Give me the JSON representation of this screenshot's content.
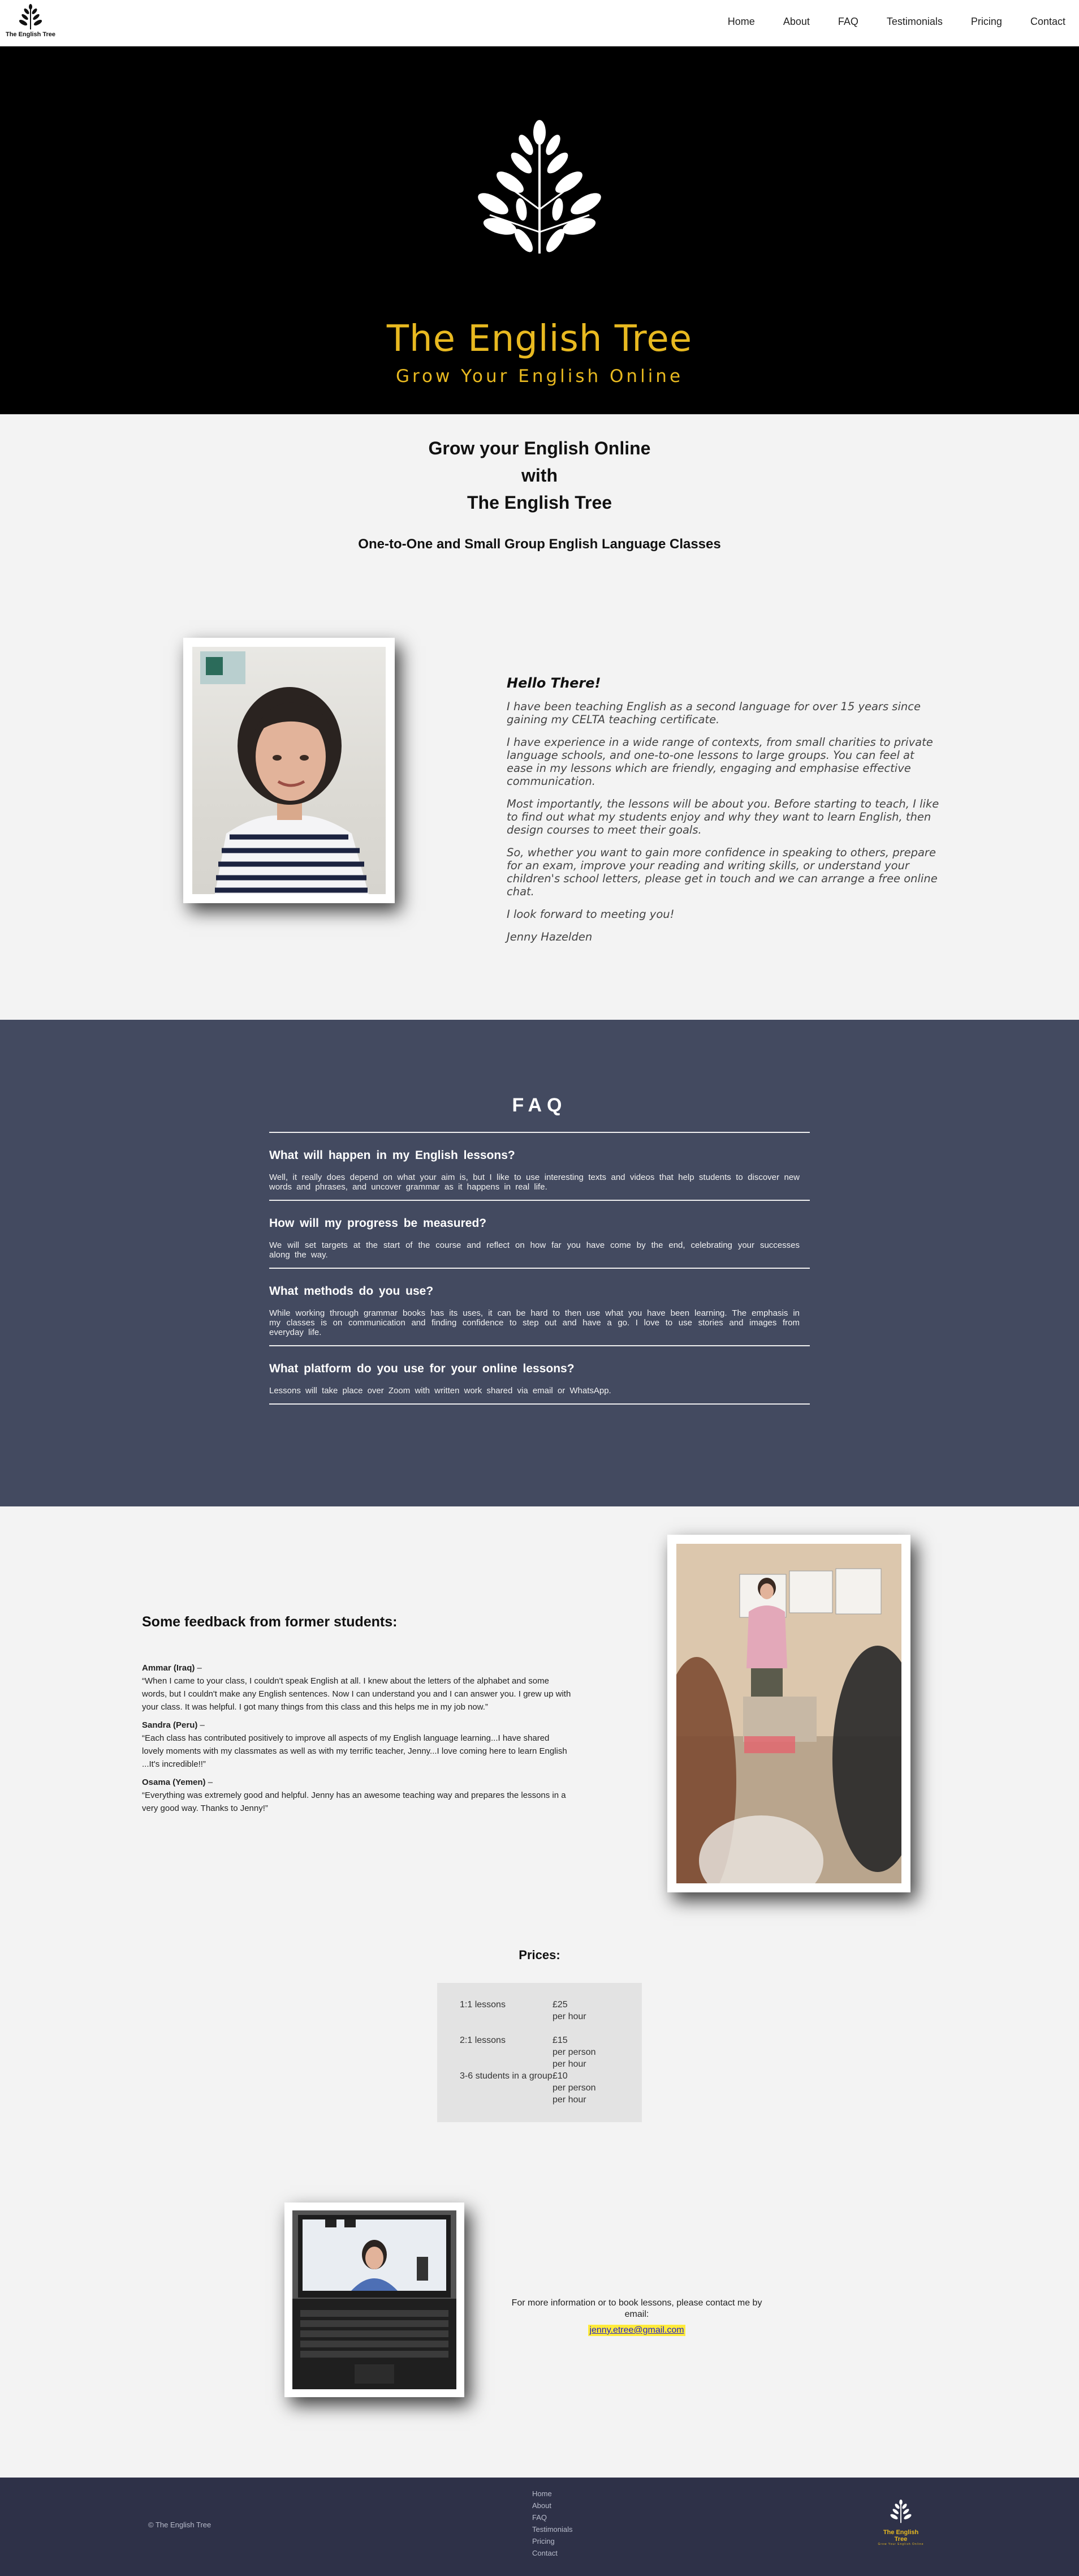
{
  "nav": {
    "logo_text": "The English Tree",
    "links": [
      "Home",
      "About",
      "FAQ",
      "Testimonials",
      "Pricing",
      "Contact"
    ]
  },
  "hero": {
    "title": "The English Tree",
    "subtitle": "Grow Your English Online"
  },
  "intro": {
    "heading_lines": [
      "Grow your English Online",
      "with",
      "The English Tree"
    ],
    "subheading": "One-to-One and Small Group English Language Classes"
  },
  "about": {
    "greeting": "Hello There!",
    "paragraphs": [
      "I have been teaching English as a second language for over 15 years since gaining my CELTA teaching certificate.",
      "I have experience in a wide range of contexts, from small charities to private language schools, and one-to-one lessons to large groups. You can feel at ease in my lessons which are friendly, engaging and emphasise effective communication.",
      "Most importantly, the lessons will be about you. Before starting to teach, I like to find out what my students enjoy and why they want to learn English, then design courses to meet their goals.",
      "So, whether you want to gain more confidence in speaking to others, prepare for an exam, improve your reading and writing skills, or understand your children's school letters, please get in touch and we can arrange a free online chat.",
      "I look forward to meeting you!",
      "Jenny Hazelden"
    ]
  },
  "faq": {
    "title": "FAQ",
    "items": [
      {
        "question": "What will happen in my English lessons?",
        "answer": "Well, it really does depend on what your aim is, but I like to use interesting texts and videos that help students to discover new words and phrases, and uncover grammar as it happens in real life."
      },
      {
        "question": "How will my progress be measured?",
        "answer": "We will set targets at the start of the course and reflect on how far you have come by the end, celebrating your successes along the way."
      },
      {
        "question": "What methods do you use?",
        "answer": "While working through grammar books has its uses, it can be hard to then use what you have been learning. The emphasis in my classes is on communication and finding confidence to step out and have a go. I love to use stories and images from everyday life."
      },
      {
        "question": "What platform do you use for your online lessons?",
        "answer": "Lessons will take place over Zoom with written work shared via email or WhatsApp."
      }
    ]
  },
  "feedback": {
    "heading": "Some feedback from former students:",
    "items": [
      {
        "name": "Ammar (Iraq)",
        "quote": "“When I came to your class, I couldn't speak English at all. I knew about the letters of the alphabet and some words, but I couldn't make any English sentences. Now I can understand you and I can answer you. I grew up with your class. It was helpful. I got many things from this class and this helps me in my job now.”"
      },
      {
        "name": "Sandra (Peru)",
        "quote": "“Each class has contributed positively to improve all aspects of my English language learning...I have shared lovely moments with my classmates as well as with my terrific teacher, Jenny...I love coming here to learn English ...It's incredible!!”"
      },
      {
        "name": "Osama (Yemen)",
        "quote": "“Everything was extremely good and helpful. Jenny has an awesome teaching way and prepares the lessons in a very good way. Thanks to Jenny!”"
      }
    ],
    "dash": "–"
  },
  "prices": {
    "title": "Prices:",
    "rows": [
      {
        "label": "1:1 lessons",
        "price": "£25",
        "unit": "per hour"
      },
      {
        "label": "2:1 lessons",
        "price": "£15",
        "unit": "per person per hour"
      },
      {
        "label": "3-6 students in a group",
        "price": "£10",
        "unit": "per person per hour"
      }
    ]
  },
  "contact": {
    "text": "For more information or to book lessons, please contact me by email:",
    "email": "jenny.etree@gmail.com"
  },
  "footer": {
    "copyright": "© The English Tree",
    "links": [
      "Home",
      "About",
      "FAQ",
      "Testimonials",
      "Pricing",
      "Contact"
    ],
    "logo_text": "The English Tree",
    "logo_sub": "Grow Your English Online"
  },
  "colors": {
    "gold": "#e8b920",
    "faq_bg": "#434a60",
    "footer_bg": "#2e3148",
    "page_bg": "#f3f3f3"
  }
}
